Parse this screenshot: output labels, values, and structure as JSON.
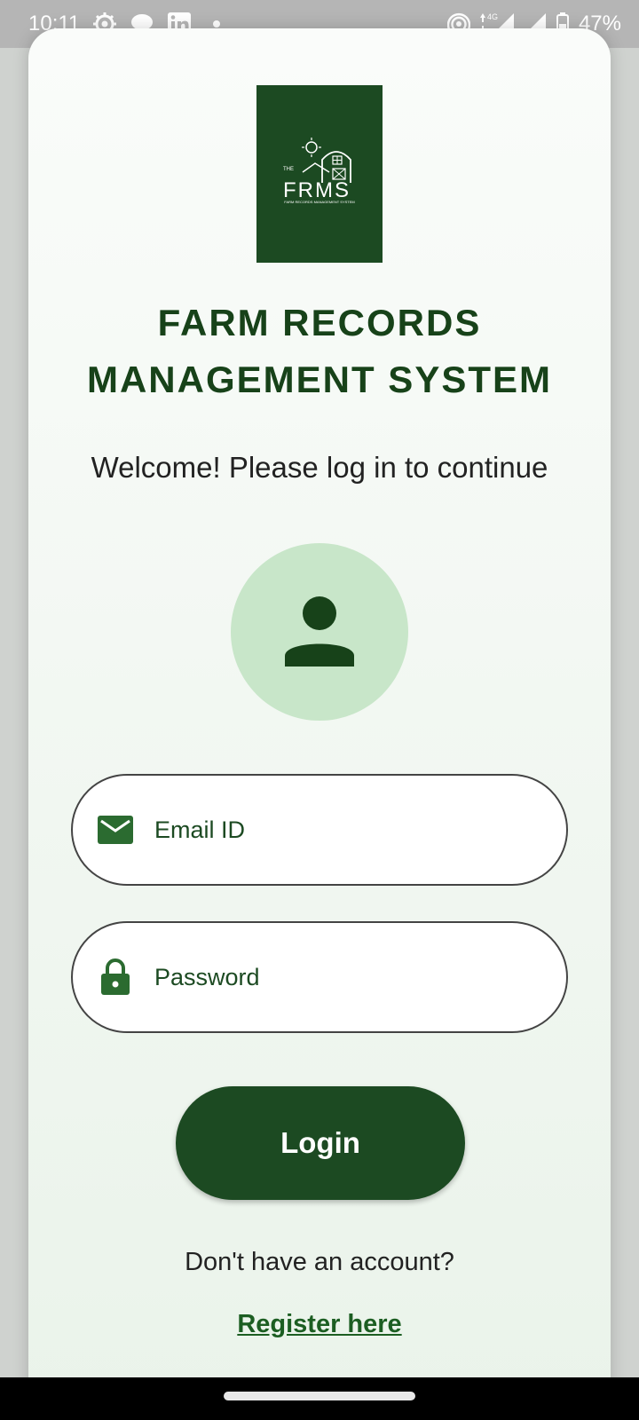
{
  "status_bar": {
    "time": "10:11",
    "battery": "47%",
    "network": "4G",
    "left_icons": [
      "settings-gear-icon",
      "chat-bubble-icon",
      "linkedin-icon",
      "notification-dot-icon"
    ],
    "right_icons": [
      "hotspot-icon",
      "signal-icon",
      "signal-icon",
      "battery-icon"
    ]
  },
  "logo": {
    "text": "FRMS",
    "small_text": "THE",
    "subtitle": "FARM RECORDS MANAGEMENT SYSTEM",
    "bg_color": "#1c4a22"
  },
  "title_line1": "FARM RECORDS",
  "title_line2": "MANAGEMENT SYSTEM",
  "welcome": "Welcome! Please log in to continue",
  "email": {
    "placeholder": "Email ID",
    "icon": "mail-icon"
  },
  "password": {
    "placeholder": "Password",
    "icon": "lock-icon"
  },
  "login_label": "Login",
  "no_account": "Don't have an account?",
  "register_label": "Register here",
  "colors": {
    "primary": "#1c4a22",
    "avatar_bg": "#c8e6c9",
    "link": "#1c5e22"
  }
}
